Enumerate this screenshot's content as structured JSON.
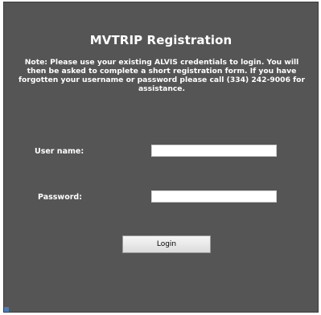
{
  "form": {
    "title": "MVTRIP Registration",
    "note": "Note: Please use your existing ALVIS credentials to login. You will then be asked to complete a short registration form. If you have forgotten your username or password please call (334) 242-9006 for assistance.",
    "username_label": "User name:",
    "username_value": "",
    "password_label": "Password:",
    "password_value": "",
    "login_label": "Login"
  },
  "colors": {
    "panel_background": "#555555",
    "text": "#ffffff",
    "button_background": "#e8e8e8"
  }
}
